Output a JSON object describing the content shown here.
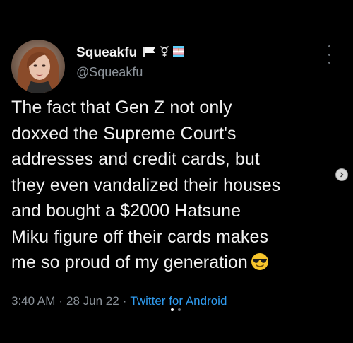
{
  "tweet": {
    "display_name": "Squeakfu",
    "handle": "@Squeakfu",
    "flag_icons": [
      "white-flag-icon",
      "transgender-symbol-icon",
      "trans-flag-icon"
    ],
    "text_lines": [
      "The fact that Gen Z not only",
      "doxxed the Supreme Court's",
      "addresses and credit cards, but",
      "they even vandalized their houses",
      "and bought a $2000 Hatsune",
      "Miku figure off their cards makes",
      "me so proud of my generation"
    ],
    "emoji": "smiling-face-with-sunglasses",
    "time": "3:40 AM",
    "date": "28 Jun 22",
    "source": "Twitter for Android"
  },
  "colors": {
    "background": "#000000",
    "text": "#f1f1f1",
    "secondary_text": "#8b9299",
    "link": "#2f9bef"
  },
  "carousel": {
    "dots": 2,
    "active_dot": 0
  }
}
